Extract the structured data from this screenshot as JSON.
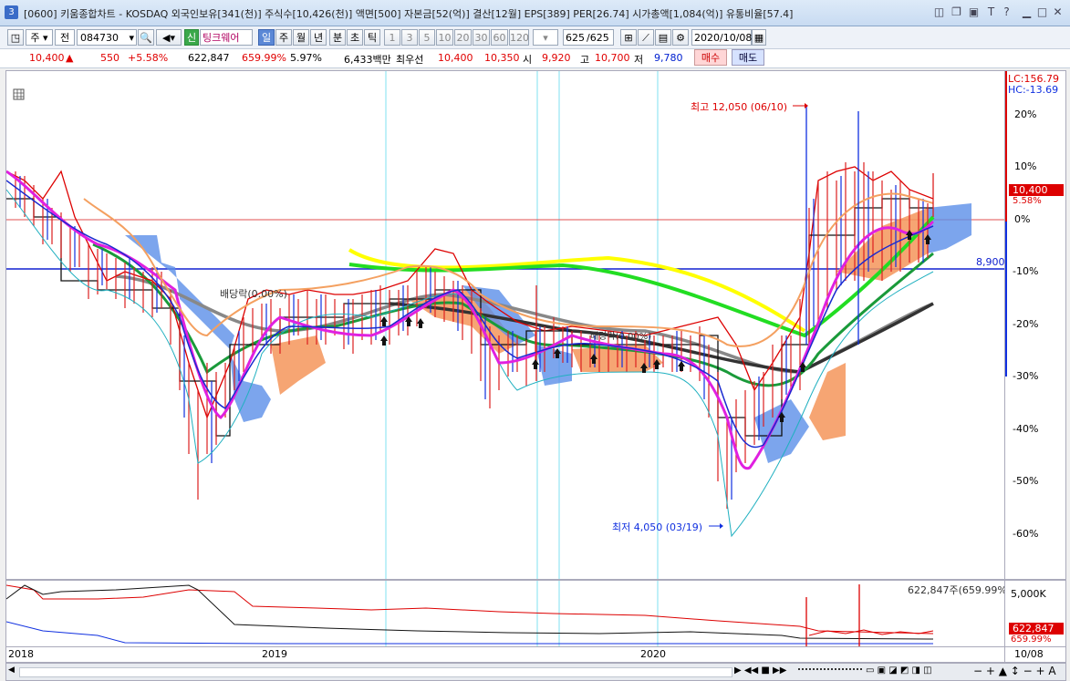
{
  "window": {
    "number": "3",
    "title": "[0600] 키움종합차트 - KOSDAQ 외국인보유[341(천)] 주식수[10,426(천)] 액면[500] 자본금[52(억)] 결산[12월] EPS[389] PER[26.74] 시가총액[1,084(억)] 유통비율[57.4]"
  },
  "toolbar": {
    "period_select": "주",
    "market_select": "전",
    "code": "084730",
    "credit_badge": "신",
    "stock_name": "팅크웨어",
    "period_buttons": [
      "일",
      "주",
      "월",
      "년",
      "분",
      "초",
      "틱"
    ],
    "interval_buttons": [
      "1",
      "3",
      "5",
      "10",
      "20",
      "30",
      "60",
      "120"
    ],
    "page_count": "625",
    "page_total": "/625",
    "date": "2020/10/08"
  },
  "quote": {
    "price": "10,400",
    "direction": "▲",
    "change": "550",
    "change_pct": "+5.58%",
    "volume": "622,847",
    "volume_ratio": "659.99%",
    "turnover": "5.97%",
    "amount": "6,433백만",
    "best_bid_label": "최우선",
    "best_ask": "10,400",
    "best_bid": "10,350",
    "open_label": "시",
    "open": "9,920",
    "high_label": "고",
    "high": "10,700",
    "low_label": "저",
    "low": "9,780",
    "buy_button": "매수",
    "sell_button": "매도"
  },
  "chart": {
    "lc_label": "LC:156.79",
    "hc_label": "HC:-13.69",
    "high_annotation": "최고 12,050 (06/10)",
    "low_annotation": "최저 4,050 (03/19)",
    "dividend_label_1": "배당락(0.00%)",
    "dividend_label_2": "배당락(0.00%)",
    "hline_value": "8,900",
    "current_price_tag": "10,400",
    "current_pct_tag": "5.58%",
    "y_ticks": [
      "20%",
      "10%",
      "0%",
      "-10%",
      "-20%",
      "-30%",
      "-40%",
      "-50%",
      "-60%"
    ],
    "volume_label": "622,847주(659.99%)",
    "volume_axis": "5,000K",
    "volume_tag": "622,847",
    "volume_pct_tag": "659.99%",
    "x_labels": [
      "2018",
      "2019",
      "2020"
    ],
    "x_last": "10/08"
  },
  "colors": {
    "up": "#e00000",
    "down": "#0020d0",
    "ma_yellow": "#ffff00",
    "ma_green": "#22dd22",
    "ma_magenta": "#e020e0",
    "cloud_blue": "#5b8fe8",
    "cloud_orange": "#f4955a"
  }
}
